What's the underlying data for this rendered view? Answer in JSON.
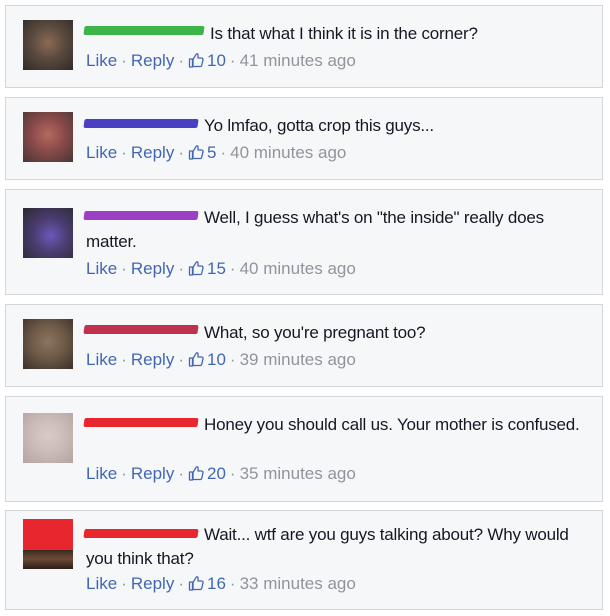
{
  "comments": [
    {
      "text": "Is that what I think it is in the corner?",
      "like": "Like",
      "reply": "Reply",
      "likes": "10",
      "time": "41 minutes ago",
      "redact_color": "#3cb44a",
      "avatar_color": "#5a4a3e"
    },
    {
      "text": "Yo lmfao, gotta crop this guys...",
      "like": "Like",
      "reply": "Reply",
      "likes": "5",
      "time": "40 minutes ago",
      "redact_color": "#4b3fc4",
      "avatar_color": "#8a4a4a"
    },
    {
      "text": "Well, I guess what's on \"the inside\" really does matter.",
      "like": "Like",
      "reply": "Reply",
      "likes": "15",
      "time": "40 minutes ago",
      "redact_color": "#9b3fc4",
      "avatar_color": "#4a3c6e"
    },
    {
      "text": "What, so you're pregnant too?",
      "like": "Like",
      "reply": "Reply",
      "likes": "10",
      "time": "39 minutes ago",
      "redact_color": "#c0304f",
      "avatar_color": "#6e5a48"
    },
    {
      "text": "Honey you should call us. Your mother is confused.",
      "like": "Like",
      "reply": "Reply",
      "likes": "20",
      "time": "35 minutes ago",
      "redact_color": "#e8262d",
      "avatar_color": "#c9b9b7"
    },
    {
      "text": "Wait... wtf are you guys talking about? Why would you think that?",
      "like": "Like",
      "reply": "Reply",
      "likes": "16",
      "time": "33 minutes ago",
      "redact_color": "#e8262d",
      "avatar_color": "#e8262d"
    }
  ],
  "icons": {
    "like_count": "thumbs-up-icon"
  }
}
